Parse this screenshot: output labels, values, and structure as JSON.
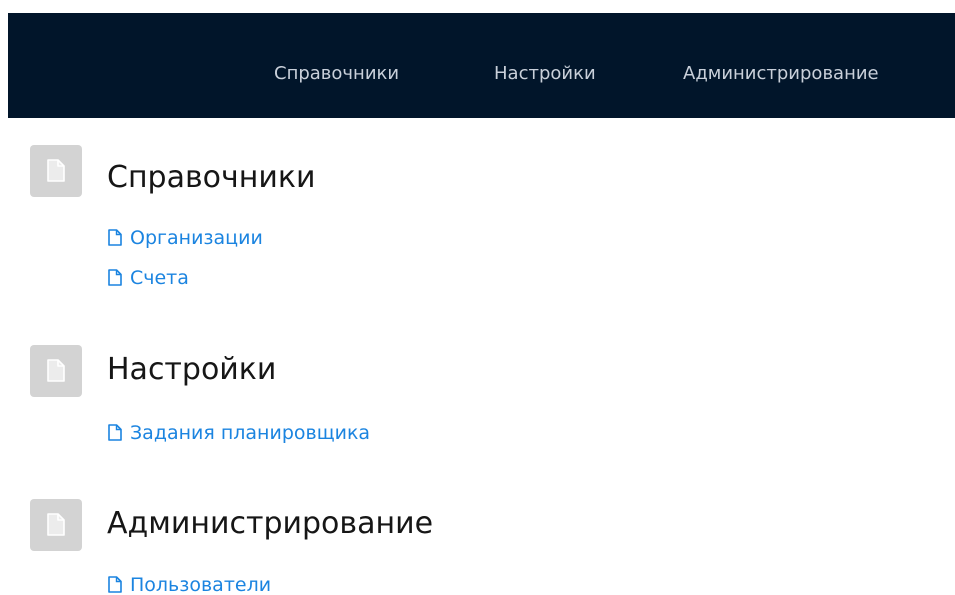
{
  "navbar": {
    "items": [
      {
        "label": "Справочники"
      },
      {
        "label": "Настройки"
      },
      {
        "label": "Администрирование"
      }
    ]
  },
  "sections": [
    {
      "icon": "document-icon",
      "title": "Справочники",
      "links": [
        {
          "icon": "document-outline-icon",
          "label": "Организации"
        },
        {
          "icon": "document-outline-icon",
          "label": "Счета"
        }
      ]
    },
    {
      "icon": "document-icon",
      "title": "Настройки",
      "links": [
        {
          "icon": "document-outline-icon",
          "label": "Задания планировщика"
        }
      ]
    },
    {
      "icon": "document-icon",
      "title": "Администрирование",
      "links": [
        {
          "icon": "document-outline-icon",
          "label": "Пользователи"
        }
      ]
    }
  ],
  "colors": {
    "navbar_bg": "#01152a",
    "navbar_text": "#c9d0da",
    "link": "#1b84e0",
    "heading": "#161616",
    "section_icon_bg": "#d3d3d3"
  }
}
